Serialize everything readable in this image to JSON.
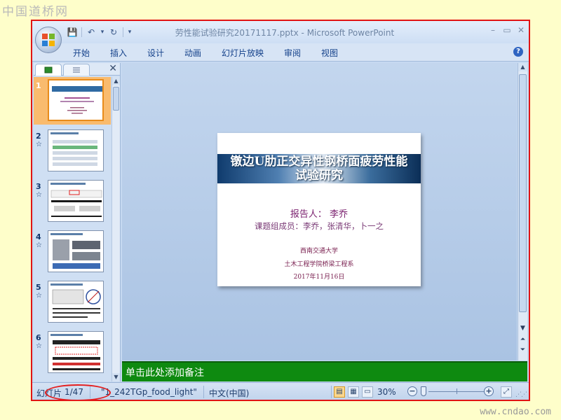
{
  "watermark": {
    "top": "中国道桥网",
    "bottom": "www.cndao.com"
  },
  "window": {
    "title": "劳性能试验研究20171117.pptx - Microsoft PowerPoint",
    "controls": [
      "–",
      "▭",
      "✕"
    ]
  },
  "ribbon": {
    "tabs": [
      "开始",
      "插入",
      "设计",
      "动画",
      "幻灯片放映",
      "审阅",
      "视图"
    ],
    "help": "?"
  },
  "quick_access": {
    "save": "💾",
    "undo": "↶",
    "dropdown": "▾",
    "redo": "↻",
    "customize": "▾"
  },
  "slides_pane": {
    "close": "✕",
    "thumbnails": [
      {
        "number": "1",
        "star": ""
      },
      {
        "number": "2",
        "star": "☆"
      },
      {
        "number": "3",
        "star": "☆"
      },
      {
        "number": "4",
        "star": "☆"
      },
      {
        "number": "5",
        "star": "☆"
      },
      {
        "number": "6",
        "star": "☆"
      }
    ]
  },
  "slide": {
    "title_line1": "镦边U肋正交异性钢桥面疲劳性能",
    "title_line2": "试验研究",
    "reporter": "报告人： 李乔",
    "members": "课题组成员：李乔，张清华，卜一之",
    "university": "西南交通大学",
    "department": "土木工程学院桥梁工程系",
    "date": "2017年11月16日"
  },
  "notes": {
    "placeholder": "单击此处添加备注"
  },
  "status_bar": {
    "slide_label": "幻灯片",
    "slide_position": "1/47",
    "theme": "\"1_242TGp_food_light\"",
    "language": "中文(中国)",
    "zoom": "30%",
    "zoom_minus": "−",
    "zoom_plus": "+"
  },
  "colors": {
    "accent": "#e11414",
    "notes_bg": "#0e8a10",
    "selected_thumb": "#f9bb6e"
  }
}
